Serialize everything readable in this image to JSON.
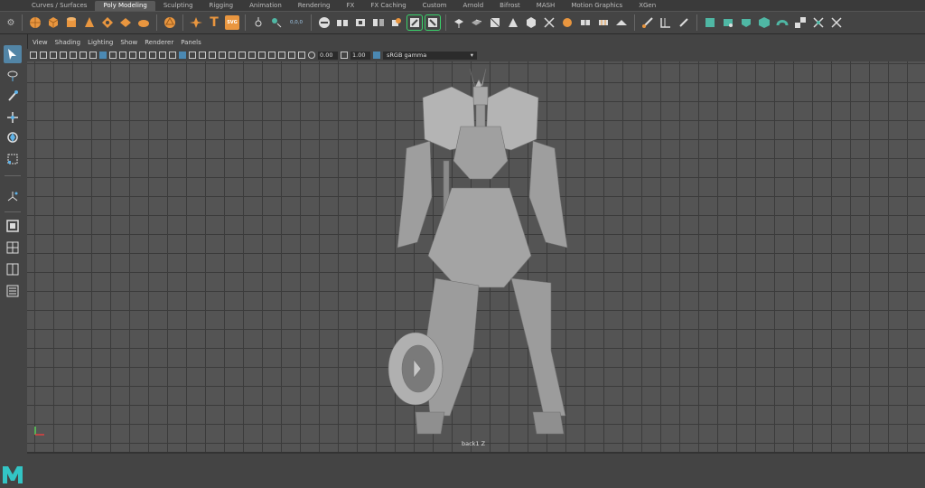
{
  "shelf_tabs": [
    "Curves / Surfaces",
    "Poly Modeling",
    "Sculpting",
    "Rigging",
    "Animation",
    "Rendering",
    "FX",
    "FX Caching",
    "Custom",
    "Arnold",
    "Bifrost",
    "MASH",
    "Motion Graphics",
    "XGen"
  ],
  "active_tab": "Poly Modeling",
  "shelf_text_icons": {
    "type": "T",
    "svg": "SVG",
    "axis_coords": "0,0,0"
  },
  "viewport_menu": [
    "View",
    "Shading",
    "Lighting",
    "Show",
    "Renderer",
    "Panels"
  ],
  "exposure_value": "0.00",
  "gamma_value": "1.00",
  "color_management": "sRGB gamma",
  "camera_name": "back1 Z",
  "logo": "M",
  "colors": {
    "accent_orange": "#e9963f",
    "teal": "#4fb7a4",
    "select_blue": "#5285a6",
    "highlight_green": "#39d36b"
  }
}
